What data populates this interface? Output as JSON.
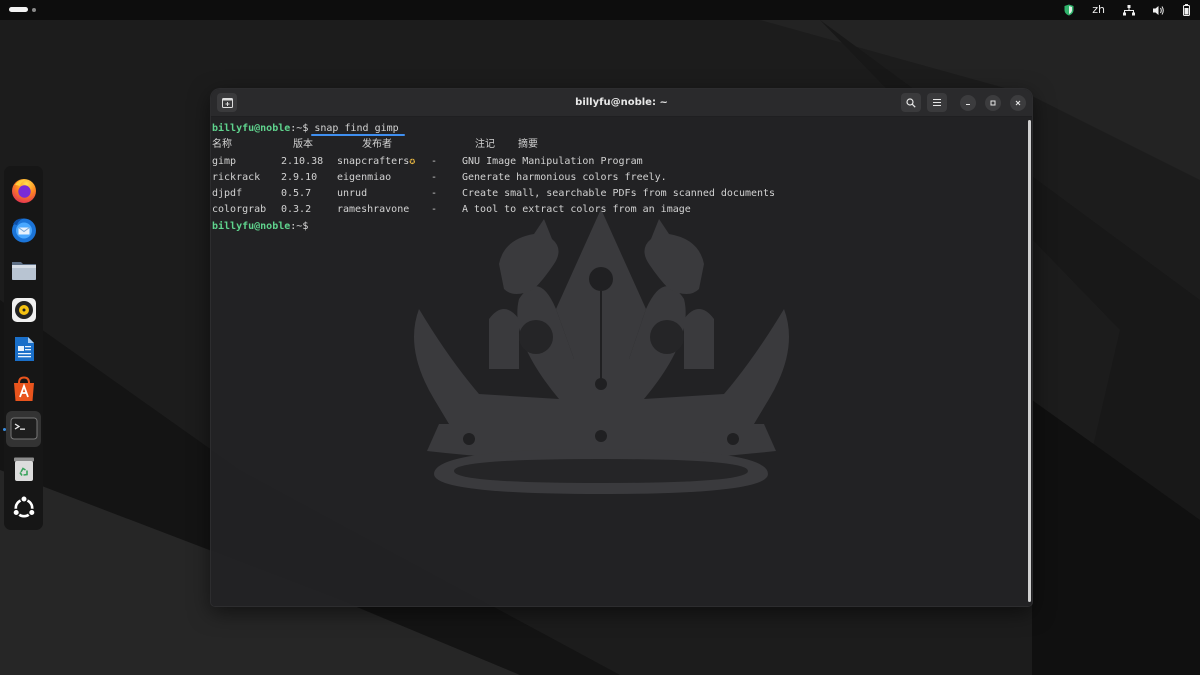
{
  "topbar": {
    "language": "zh"
  },
  "dock": {
    "items": [
      {
        "name": "firefox",
        "icon": "firefox-icon"
      },
      {
        "name": "thunderbird",
        "icon": "thunderbird-icon"
      },
      {
        "name": "files",
        "icon": "files-icon"
      },
      {
        "name": "rhythmbox",
        "icon": "rhythmbox-icon"
      },
      {
        "name": "libreoffice-writer",
        "icon": "writer-icon"
      },
      {
        "name": "app-center",
        "icon": "app-center-icon"
      },
      {
        "name": "terminal",
        "icon": "terminal-icon",
        "active": true
      },
      {
        "name": "trash",
        "icon": "trash-icon"
      },
      {
        "name": "show-apps",
        "icon": "ubuntu-icon"
      }
    ]
  },
  "terminal": {
    "title": "billyfu@noble: ~",
    "prompt_user": "billyfu@noble",
    "prompt_path": ":~$ ",
    "command": "snap find gimp",
    "headers": {
      "name": "名称",
      "version": "版本",
      "publisher": "发布者",
      "notes": "注记",
      "summary": "摘要"
    },
    "rows": [
      {
        "name": "gimp",
        "version": "2.10.38",
        "publisher": "snapcrafters",
        "verified": "✪",
        "notes": "-",
        "summary": "GNU Image Manipulation Program"
      },
      {
        "name": "rickrack",
        "version": "2.9.10",
        "publisher": "eigenmiao",
        "verified": "",
        "notes": "-",
        "summary": "Generate harmonious colors freely."
      },
      {
        "name": "djpdf",
        "version": "0.5.7",
        "publisher": "unrud",
        "verified": "",
        "notes": "-",
        "summary": "Create small, searchable PDFs from scanned documents"
      },
      {
        "name": "colorgrab",
        "version": "0.3.2",
        "publisher": "rameshravone",
        "verified": "",
        "notes": "-",
        "summary": "A tool to extract colors from an image"
      }
    ]
  },
  "colors": {
    "prompt_green": "#5fd38d",
    "accent_blue": "#3f8ff0",
    "verified_star": "#e3b341"
  }
}
